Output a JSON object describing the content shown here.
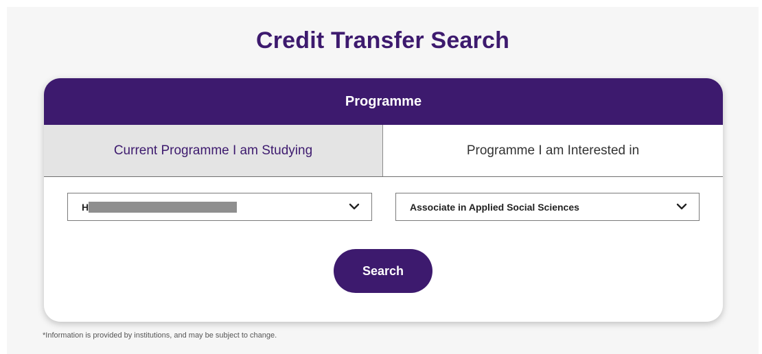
{
  "page": {
    "title": "Credit Transfer Search",
    "footnote": "*Information is provided by institutions, and may be subject to change."
  },
  "card": {
    "header": "Programme",
    "tabs": [
      {
        "label": "Current Programme I am Studying",
        "active": true
      },
      {
        "label": "Programme I am Interested in",
        "active": false
      }
    ],
    "current_programme_select": {
      "value_prefix": "H",
      "redacted": true,
      "icon": "chevron-down-icon"
    },
    "interested_programme_select": {
      "value": "Associate in Applied Social Sciences",
      "icon": "chevron-down-icon"
    },
    "search_label": "Search"
  },
  "colors": {
    "brand_purple": "#3d1a6e",
    "active_tab_bg": "#e4e4e4",
    "page_bg": "#f6f6f6"
  }
}
